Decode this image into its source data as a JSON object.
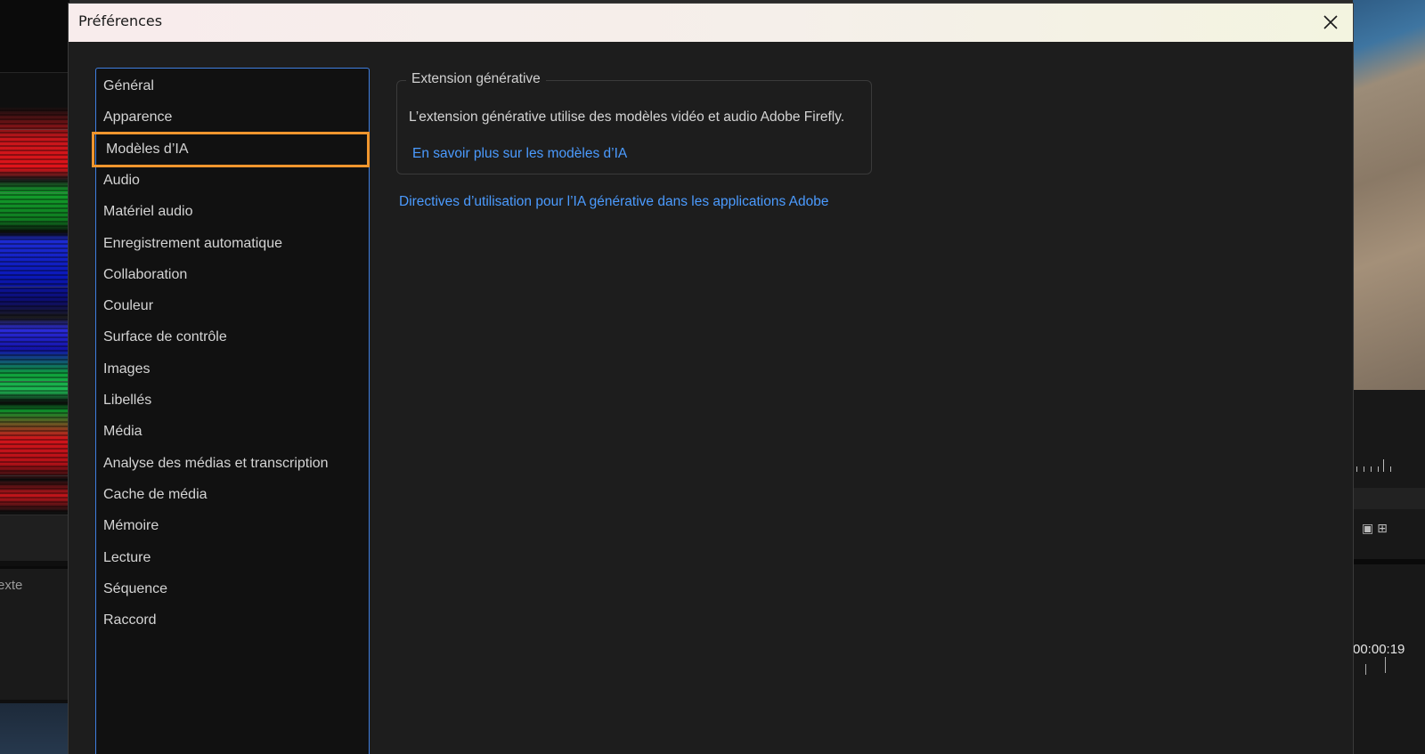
{
  "dialog": {
    "title": "Préférences",
    "close_icon": "close-icon"
  },
  "categories": [
    {
      "label": "Général"
    },
    {
      "label": "Apparence"
    },
    {
      "label": "Modèles d’IA",
      "selected": true
    },
    {
      "label": "Audio"
    },
    {
      "label": "Matériel audio"
    },
    {
      "label": "Enregistrement automatique"
    },
    {
      "label": "Collaboration"
    },
    {
      "label": "Couleur"
    },
    {
      "label": "Surface de contrôle"
    },
    {
      "label": "Images"
    },
    {
      "label": "Libellés"
    },
    {
      "label": "Média"
    },
    {
      "label": "Analyse des médias et transcription"
    },
    {
      "label": "Cache de média"
    },
    {
      "label": "Mémoire"
    },
    {
      "label": "Lecture"
    },
    {
      "label": "Séquence"
    },
    {
      "label": "Raccord"
    }
  ],
  "content": {
    "group_title": "Extension générative",
    "description": "L’extension générative utilise des modèles vidéo et audio Adobe Firefly.",
    "learn_more_link": "En savoir plus sur les modèles d’IA",
    "guidelines_link": "Directives d’utilisation pour l’IA générative dans les applications Adobe"
  },
  "background_app": {
    "left_panel_text": "exte",
    "right_timecode": "00:00:19"
  },
  "colors": {
    "accent_link": "#4b9bff",
    "selection_highlight": "#f0962e",
    "list_focus_border": "#3f7ee0"
  }
}
